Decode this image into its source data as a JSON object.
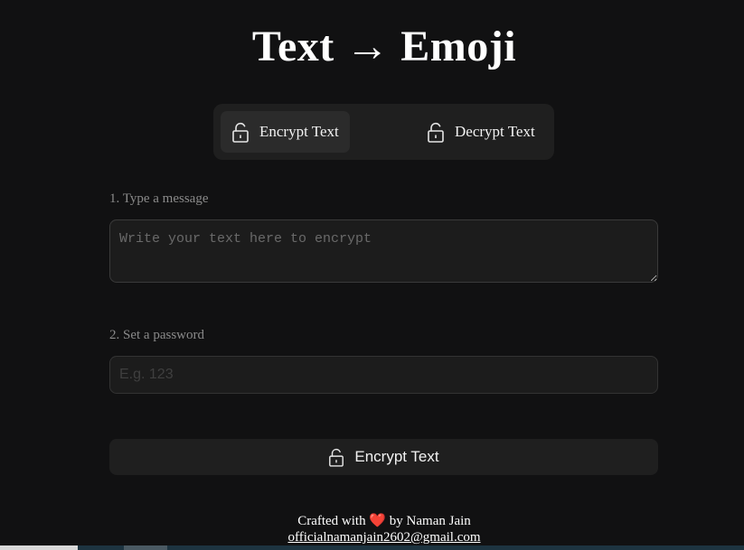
{
  "header": {
    "title": "Text → Emoji"
  },
  "mode_switch": {
    "encrypt_label": "Encrypt Text",
    "decrypt_label": "Decrypt Text",
    "active": "encrypt"
  },
  "form": {
    "message_label": "1. Type a message",
    "message_placeholder": "Write your text here to encrypt",
    "message_value": "",
    "password_label": "2. Set a password",
    "password_placeholder": "E.g. 123",
    "password_value": "",
    "submit_label": "Encrypt Text"
  },
  "footer": {
    "crafted_prefix": "Crafted with",
    "heart_icon": "heart-icon",
    "crafted_suffix": "by Naman Jain",
    "email": "officialnamanjain2602@gmail.com"
  },
  "colors": {
    "background": "#111112",
    "panel": "#1f1f1f",
    "heart": "#e01530"
  }
}
